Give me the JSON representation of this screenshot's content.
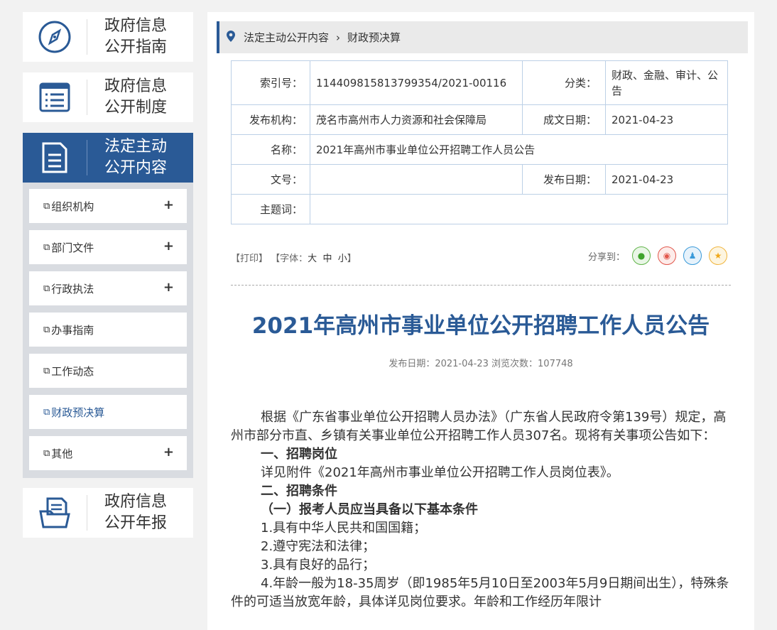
{
  "sidebar": {
    "cards": [
      {
        "title1": "政府信息",
        "title2": "公开指南",
        "icon": "compass-icon"
      },
      {
        "title1": "政府信息",
        "title2": "公开制度",
        "icon": "list-document-icon"
      },
      {
        "title1": "法定主动",
        "title2": "公开内容",
        "icon": "document-icon"
      },
      {
        "title1": "政府信息",
        "title2": "公开年报",
        "icon": "folder-document-icon"
      }
    ],
    "submenu": [
      {
        "label": "组织机构",
        "plus": "+"
      },
      {
        "label": "部门文件",
        "plus": "+"
      },
      {
        "label": "行政执法",
        "plus": "+"
      },
      {
        "label": "办事指南"
      },
      {
        "label": "工作动态"
      },
      {
        "label": "财政预决算"
      },
      {
        "label": "其他",
        "plus": "+"
      }
    ]
  },
  "breadcrumb": {
    "level1": "法定主动公开内容",
    "level2": "财政预决算"
  },
  "meta": {
    "index_label": "索引号：",
    "index_value": "114409815813799354/2021-00116",
    "category_label": "分类：",
    "category_value": "财政、金融、审计、公告",
    "publisher_label": "发布机构：",
    "publisher_value": "茂名市高州市人力资源和社会保障局",
    "written_date_label": "成文日期：",
    "written_date_value": "2021-04-23",
    "name_label": "名称：",
    "name_value": "2021年高州市事业单位公开招聘工作人员公告",
    "doc_no_label": "文号：",
    "doc_no_value": "",
    "pub_date_label": "发布日期：",
    "pub_date_value": "2021-04-23",
    "keywords_label": "主题词：",
    "keywords_value": ""
  },
  "tools": {
    "print": "【打印】",
    "font_prefix": "【字体：",
    "large": "大",
    "medium": "中",
    "small": "小",
    "font_suffix": "】",
    "share_label": "分享到："
  },
  "article": {
    "title": "2021年高州市事业单位公开招聘工作人员公告",
    "pub_info": "发布日期：2021-04-23  浏览次数：107748",
    "paragraphs": [
      "根据《广东省事业单位公开招聘人员办法》（广东省人民政府令第139号）规定，高州市部分市直、乡镇有关事业单位公开招聘工作人员307名。现将有关事项公告如下：",
      "一、招聘岗位",
      "详见附件《2021年高州市事业单位公开招聘工作人员岗位表》。",
      "二、招聘条件",
      "（一）报考人员应当具备以下基本条件",
      "1.具有中华人民共和国国籍；",
      "2.遵守宪法和法律；",
      "3.具有良好的品行；",
      "4.年龄一般为18-35周岁（即1985年5月10日至2003年5月9日期间出生），特殊条件的可适当放宽年龄，具体详见岗位要求。年龄和工作经历年限计"
    ]
  }
}
